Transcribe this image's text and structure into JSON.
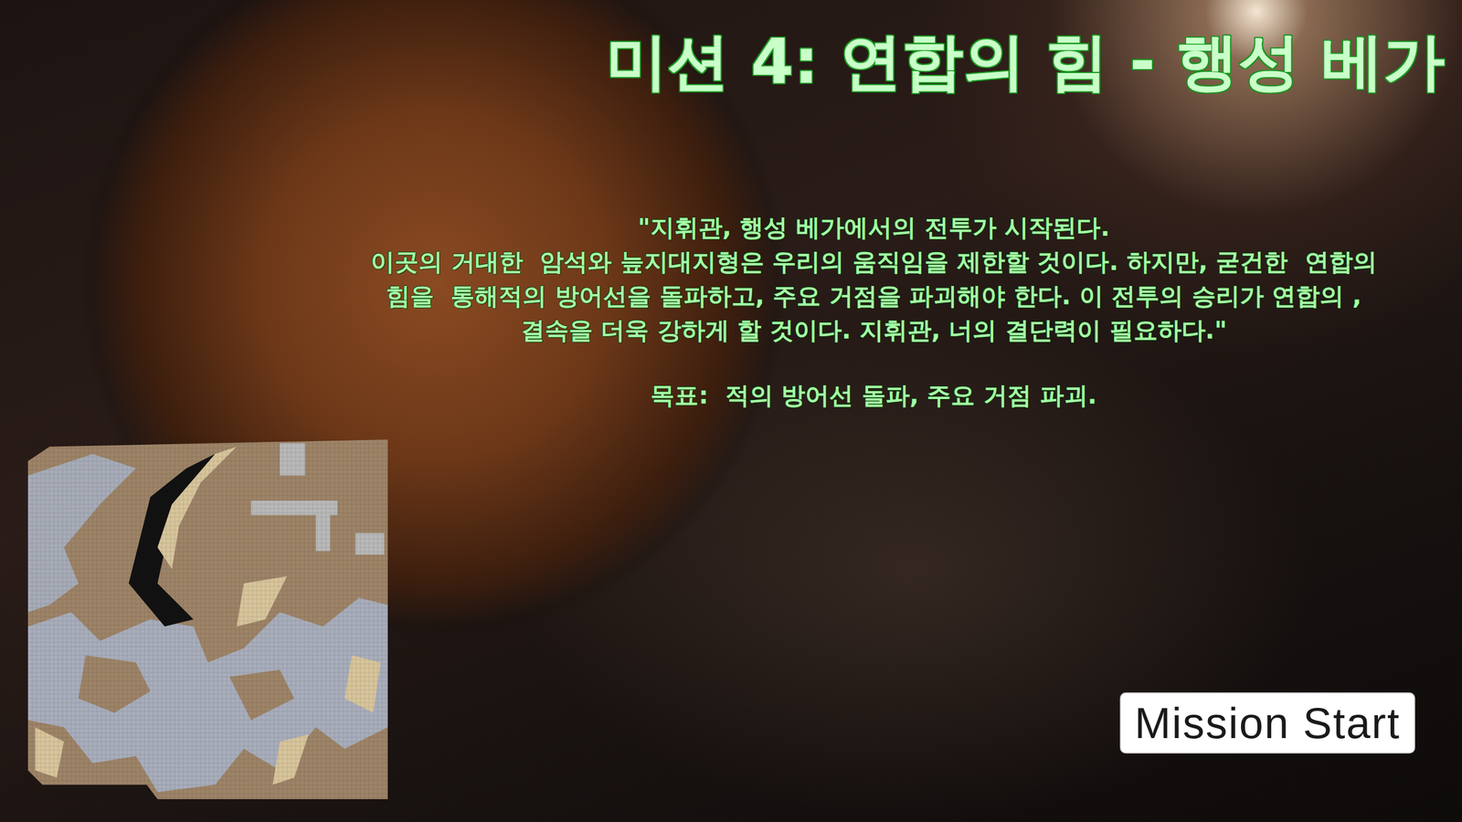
{
  "mission": {
    "title": "미션 4: 연합의 힘 - 행성 베가",
    "briefing": [
      "\"지휘관, 행성 베가에서의 전투가 시작된다.",
      "이곳의 거대한  암석와 늪지대지형은 우리의 움직임을 제한할 것이다. 하지만, 굳건한  연합의",
      "힘을  통해적의 방어선을 돌파하고, 주요 거점을 파괴해야 한다. 이 전투의 승리가 연합의 ,",
      "결속을 더욱 강하게 할 것이다. 지휘관, 너의 결단력이 필요하다.\""
    ],
    "objective": "목표:  적의 방어선 돌파, 주요 거점 파괴."
  },
  "start_button": {
    "label": "Mission Start"
  }
}
